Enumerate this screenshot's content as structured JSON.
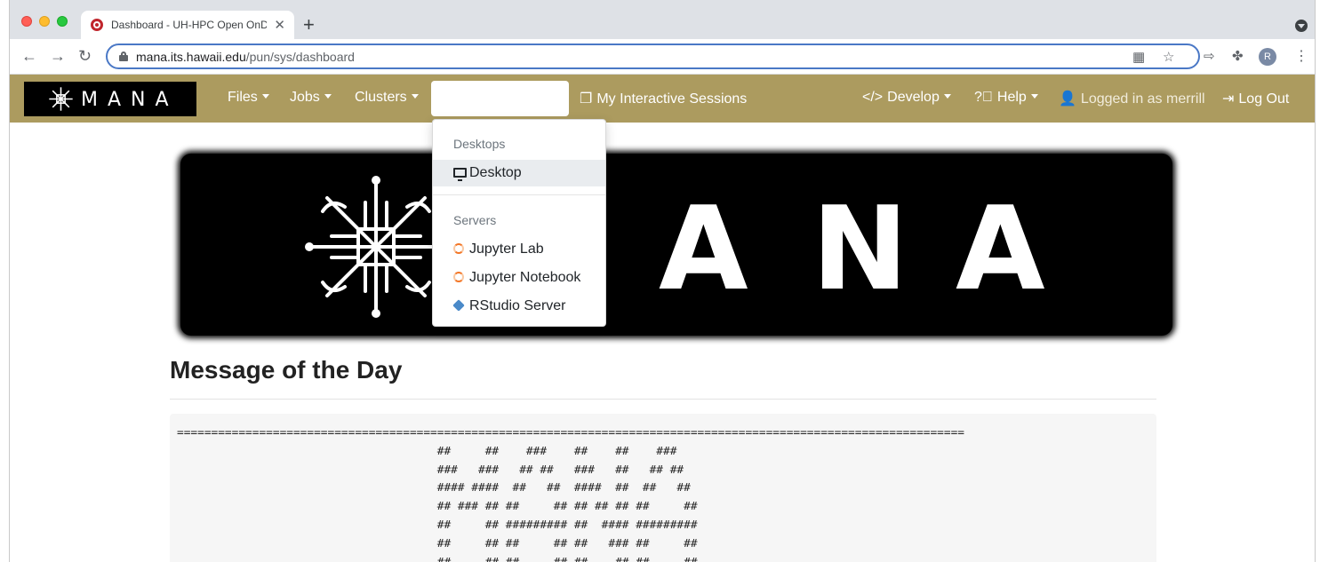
{
  "browser": {
    "tab_title": "Dashboard - UH-HPC Open OnDemand",
    "tab_close": "✕",
    "new_tab": "+",
    "url_host": "mana.its.hawaii.edu",
    "url_path": "/pun/sys/dashboard",
    "profile_initial": "R"
  },
  "navbar": {
    "logo_text": "MANA",
    "files": "Files",
    "jobs": "Jobs",
    "clusters": "Clusters",
    "sessions": "My Interactive Sessions",
    "develop": "Develop",
    "help": "Help",
    "user": "Logged in as merrill",
    "logout": "Log Out",
    "brand_color": "#ac9b5f"
  },
  "dropdown": {
    "desktops_header": "Desktops",
    "desktop": "Desktop",
    "servers_header": "Servers",
    "jupyter_lab": "Jupyter Lab",
    "jupyter_notebook": "Jupyter Notebook",
    "rstudio": "RStudio Server"
  },
  "banner": {
    "letters": [
      "A",
      "N",
      "A"
    ]
  },
  "motd": {
    "title": "Message of the Day",
    "text": "===================================================================================================================\n                                      ##     ##    ###    ##    ##    ###\n                                      ###   ###   ## ##   ###   ##   ## ##\n                                      #### ####  ##   ##  ####  ##  ##   ##\n                                      ## ### ## ##     ## ## ## ## ##     ##\n                                      ##     ## ######### ##  #### #########\n                                      ##     ## ##     ## ##   ### ##     ##\n                                      ##     ## ##     ## ##    ## ##     ##"
  }
}
